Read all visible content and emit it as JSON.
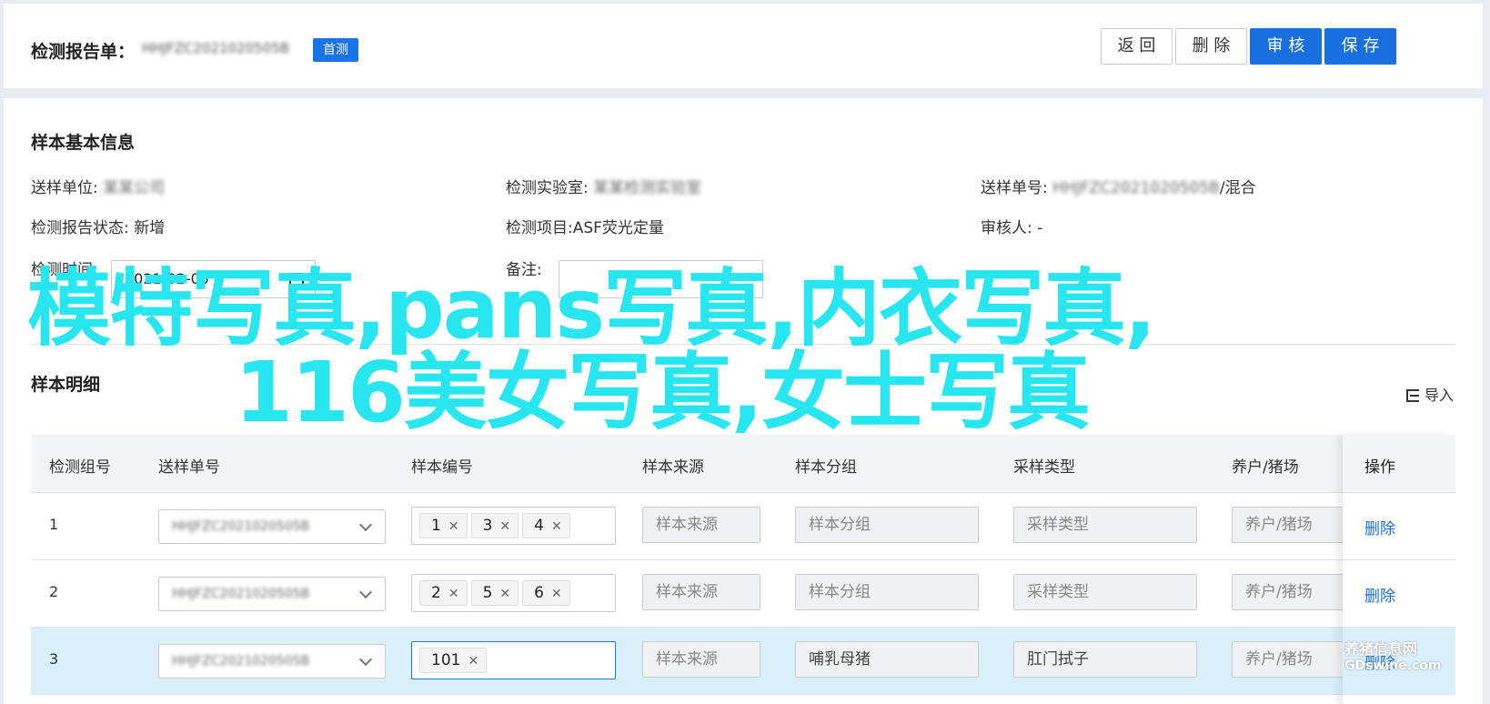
{
  "header": {
    "title": "检测报告单：",
    "report_no": "HHJFZC2021020505B",
    "tag": "首测",
    "buttons": {
      "back": "返 回",
      "delete": "删 除",
      "review": "审 核",
      "save": "保 存"
    }
  },
  "basic_info": {
    "title": "样本基本信息",
    "send_unit_label": "送样单位:",
    "send_unit_value": "某某公司",
    "lab_label": "检测实验室:",
    "lab_value": "某某检测实验室",
    "send_no_label": "送样单号:",
    "send_no_value": "HHJFZC2021020505B",
    "send_no_suffix": "/混合",
    "status_label": "检测报告状态:",
    "status_value": "新增",
    "item_label": "检测项目:",
    "item_value": "ASF荧光定量",
    "reviewer_label": "审核人:",
    "reviewer_value": "-",
    "time_label": "检测时间:",
    "time_value": "2021-02-05",
    "remark_label": "备注:"
  },
  "detail": {
    "title": "样本明细",
    "import_label": "导入",
    "columns": [
      "检测组号",
      "送样单号",
      "样本编号",
      "样本来源",
      "样本分组",
      "采样类型",
      "养户/猪场",
      "操作"
    ],
    "rows": [
      {
        "group": "1",
        "send_no": "HHJFZC2021020505B",
        "samples": [
          "1",
          "3",
          "4"
        ],
        "source": "样本来源",
        "sgroup": "样本分组",
        "stype": "采样类型",
        "farm": "养户/猪场",
        "op": "删除"
      },
      {
        "group": "2",
        "send_no": "HHJFZC2021020505B",
        "samples": [
          "2",
          "5",
          "6"
        ],
        "source": "样本来源",
        "sgroup": "样本分组",
        "stype": "采样类型",
        "farm": "养户/猪场",
        "op": "删除"
      },
      {
        "group": "3",
        "send_no": "HHJFZC2021020505B",
        "samples": [
          "101"
        ],
        "source": "样本来源",
        "sgroup": "哺乳母猪",
        "stype": "肛门拭子",
        "farm": "养户/猪场",
        "op": "删除"
      }
    ]
  },
  "overlay": {
    "line1": "模特写真,pans写真,内衣写真,",
    "line2": "116美女写真,女士写真"
  },
  "watermark": {
    "line1": "养猪信息网",
    "line2": "GDswine.com"
  },
  "colors": {
    "primary": "#1a6fe0",
    "overlay": "#27e6f0",
    "selected_row": "#d9f0fb"
  }
}
